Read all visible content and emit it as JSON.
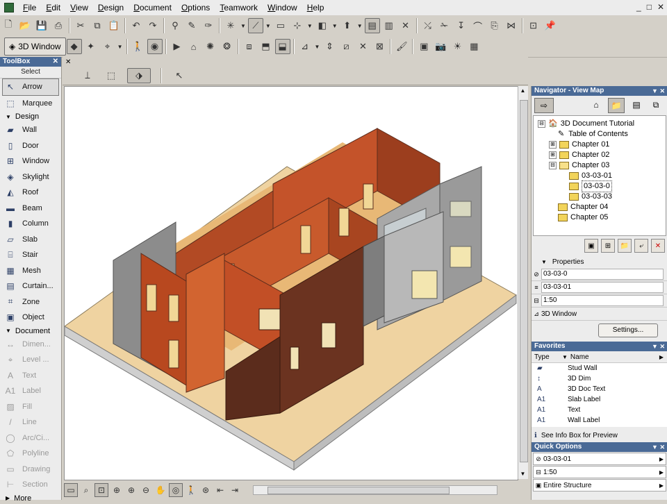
{
  "menu": [
    "File",
    "Edit",
    "View",
    "Design",
    "Document",
    "Options",
    "Teamwork",
    "Window",
    "Help"
  ],
  "window_controls": [
    "_",
    "□",
    "✕"
  ],
  "view_button_label": "3D Window",
  "toolbox": {
    "title": "ToolBox",
    "select_label": "Select",
    "tools_top": [
      {
        "label": "Arrow",
        "icon": "arrow-icon",
        "glyph": "↖"
      },
      {
        "label": "Marquee",
        "icon": "marquee-icon",
        "glyph": "⬚"
      }
    ],
    "design_label": "Design",
    "design_tools": [
      {
        "label": "Wall",
        "icon": "wall-icon",
        "glyph": "▰"
      },
      {
        "label": "Door",
        "icon": "door-icon",
        "glyph": "▯"
      },
      {
        "label": "Window",
        "icon": "window-icon",
        "glyph": "⊞"
      },
      {
        "label": "Skylight",
        "icon": "skylight-icon",
        "glyph": "◈"
      },
      {
        "label": "Roof",
        "icon": "roof-icon",
        "glyph": "◭"
      },
      {
        "label": "Beam",
        "icon": "beam-icon",
        "glyph": "▬"
      },
      {
        "label": "Column",
        "icon": "column-icon",
        "glyph": "▮"
      },
      {
        "label": "Slab",
        "icon": "slab-icon",
        "glyph": "▱"
      },
      {
        "label": "Stair",
        "icon": "stair-icon",
        "glyph": "⌸"
      },
      {
        "label": "Mesh",
        "icon": "mesh-icon",
        "glyph": "▦"
      },
      {
        "label": "Curtain...",
        "icon": "curtain-wall-icon",
        "glyph": "▤"
      },
      {
        "label": "Zone",
        "icon": "zone-icon",
        "glyph": "⌗"
      },
      {
        "label": "Object",
        "icon": "object-icon",
        "glyph": "▣"
      }
    ],
    "document_label": "Document",
    "document_tools": [
      {
        "label": "Dimen...",
        "icon": "dimension-icon",
        "glyph": "↔"
      },
      {
        "label": "Level ...",
        "icon": "level-dimension-icon",
        "glyph": "⌖"
      },
      {
        "label": "Text",
        "icon": "text-icon",
        "glyph": "A"
      },
      {
        "label": "Label",
        "icon": "label-icon",
        "glyph": "A1"
      },
      {
        "label": "Fill",
        "icon": "fill-icon",
        "glyph": "▨"
      },
      {
        "label": "Line",
        "icon": "line-icon",
        "glyph": "/"
      },
      {
        "label": "Arc/Ci...",
        "icon": "arc-icon",
        "glyph": "◯"
      },
      {
        "label": "Polyline",
        "icon": "polyline-icon",
        "glyph": "⬠"
      },
      {
        "label": "Drawing",
        "icon": "drawing-icon",
        "glyph": "▭"
      },
      {
        "label": "Section",
        "icon": "section-icon",
        "glyph": "⊢"
      }
    ],
    "more_label": "More"
  },
  "navigator": {
    "title": "Navigator - View Map",
    "tree": [
      {
        "label": "3D Document Tutorial",
        "level": 0,
        "expander": "⊟",
        "kind": "project"
      },
      {
        "label": "Table of Contents",
        "level": 1,
        "expander": "",
        "kind": "doc"
      },
      {
        "label": "Chapter 01",
        "level": 1,
        "expander": "⊞",
        "kind": "folder"
      },
      {
        "label": "Chapter 02",
        "level": 1,
        "expander": "⊞",
        "kind": "folder"
      },
      {
        "label": "Chapter 03",
        "level": 1,
        "expander": "⊟",
        "kind": "folder-open"
      },
      {
        "label": "03-03-01",
        "level": 2,
        "expander": "",
        "kind": "folder"
      },
      {
        "label": "03-03-0",
        "level": 2,
        "expander": "",
        "kind": "view",
        "selected": true
      },
      {
        "label": "03-03-03",
        "level": 2,
        "expander": "",
        "kind": "view"
      },
      {
        "label": "Chapter 04",
        "level": 1,
        "expander": "",
        "kind": "folder"
      },
      {
        "label": "Chapter 05",
        "level": 1,
        "expander": "",
        "kind": "folder"
      }
    ],
    "properties_label": "Properties",
    "properties": [
      "03-03-0",
      "03-03-01",
      "1:50",
      "3D Window"
    ],
    "settings_label": "Settings..."
  },
  "favorites": {
    "title": "Favorites",
    "col_type": "Type",
    "col_name": "Name",
    "items": [
      {
        "icon": "stud-wall-icon",
        "type_glyph": "▰",
        "name": "Stud Wall"
      },
      {
        "icon": "3d-dim-icon",
        "type_glyph": "↕",
        "name": "3D Dim"
      },
      {
        "icon": "text-icon",
        "type_glyph": "A",
        "name": "3D Doc Text"
      },
      {
        "icon": "label-icon",
        "type_glyph": "A1",
        "name": "Slab Label"
      },
      {
        "icon": "label-icon",
        "type_glyph": "A1",
        "name": "Text"
      },
      {
        "icon": "label-icon",
        "type_glyph": "A1",
        "name": "Wall Label"
      }
    ],
    "info_text": "See Info Box for Preview"
  },
  "quick_options": {
    "title": "Quick Options",
    "rows": [
      "03-03-01",
      "1:50",
      "Entire Structure"
    ]
  },
  "colors": {
    "panel_title": "#4a6a96",
    "wall_orange": "#c4532a",
    "wall_dark": "#5b2c1c",
    "wall_grey": "#8c8c8c",
    "floor": "#e8b876"
  }
}
